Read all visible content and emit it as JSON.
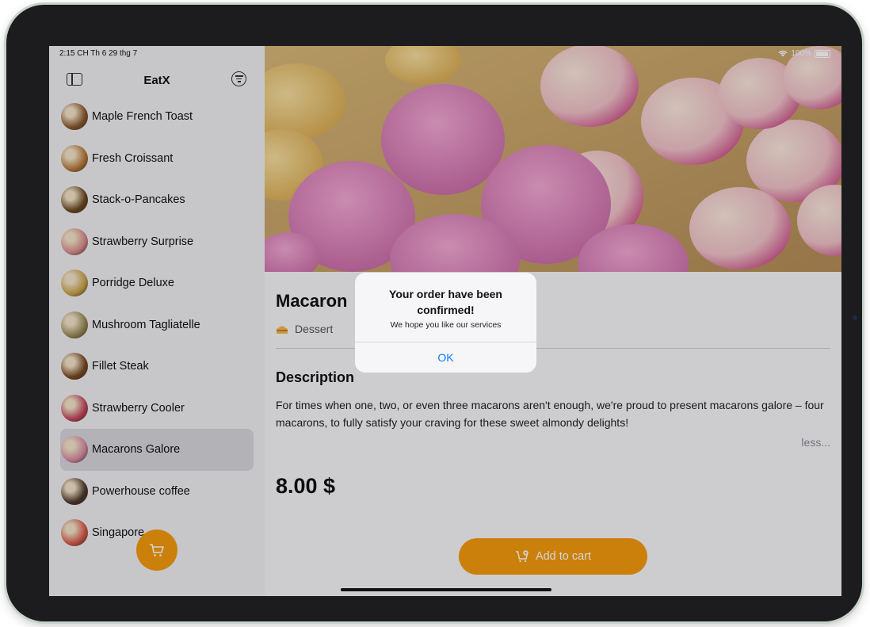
{
  "status": {
    "time": "2:15 CH  Th 6 29 thg 7",
    "battery": "100%"
  },
  "sidebar": {
    "title": "EatX",
    "items": [
      {
        "label": "Maple French Toast",
        "thumb_color": "#8a5a2e"
      },
      {
        "label": "Fresh Croissant",
        "thumb_color": "#b7793c"
      },
      {
        "label": "Stack-o-Pancakes",
        "thumb_color": "#6a4a22"
      },
      {
        "label": "Strawberry Surprise",
        "thumb_color": "#d88a8c"
      },
      {
        "label": "Porridge Deluxe",
        "thumb_color": "#c9a34b"
      },
      {
        "label": "Mushroom Tagliatelle",
        "thumb_color": "#9a8a5b"
      },
      {
        "label": "Fillet Steak",
        "thumb_color": "#7a4a24"
      },
      {
        "label": "Strawberry Cooler",
        "thumb_color": "#c44860"
      },
      {
        "label": "Macarons Galore",
        "thumb_color": "#d78aa4"
      },
      {
        "label": "Powerhouse coffee",
        "thumb_color": "#4e3a2a"
      },
      {
        "label": "Singapore",
        "thumb_color": "#d65a4a"
      }
    ],
    "selected_index": 8
  },
  "detail": {
    "title": "Macaron",
    "category": "Dessert",
    "description_heading": "Description",
    "description": "For times when one, two, or even three macarons aren't enough, we're proud to present macarons galore – four macarons, to fully satisfy your craving for these sweet almondy delights!",
    "less_label": "less...",
    "price": "8.00 $",
    "add_to_cart_label": "Add to cart"
  },
  "alert": {
    "title": "Your order have been confirmed!",
    "message": "We hope you like our services",
    "ok_label": "OK"
  },
  "colors": {
    "accent": "#f39a0d",
    "link": "#0a7aff"
  },
  "icons": {
    "sidebar_toggle": "sidebar-icon",
    "filter": "filter-icon",
    "cart": "cart-icon",
    "category": "cake-icon"
  }
}
